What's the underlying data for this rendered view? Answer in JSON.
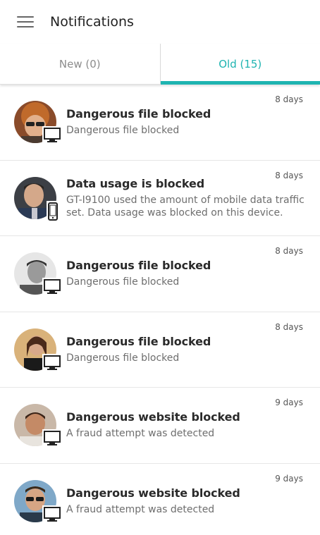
{
  "header": {
    "title": "Notifications"
  },
  "tabs": [
    {
      "label": "New (0)",
      "active": false
    },
    {
      "label": "Old (15)",
      "active": true
    }
  ],
  "accent": "#1fb4b1",
  "notifications": [
    {
      "title": "Dangerous file blocked",
      "desc": "Dangerous file blocked",
      "time": "8 days",
      "device": "monitor-icon"
    },
    {
      "title": "Data usage is blocked",
      "desc": "GT-I9100 used the amount of mobile data traffic set. Data usage was blocked on this device.",
      "time": "8 days",
      "device": "phone-icon"
    },
    {
      "title": "Dangerous file blocked",
      "desc": "Dangerous file blocked",
      "time": "8 days",
      "device": "monitor-icon"
    },
    {
      "title": "Dangerous file blocked",
      "desc": "Dangerous file blocked",
      "time": "8 days",
      "device": "monitor-icon"
    },
    {
      "title": "Dangerous website blocked",
      "desc": "A fraud attempt was detected",
      "time": "9 days",
      "device": "monitor-icon"
    },
    {
      "title": "Dangerous website blocked",
      "desc": "A fraud attempt was detected",
      "time": "9 days",
      "device": "monitor-icon"
    }
  ]
}
